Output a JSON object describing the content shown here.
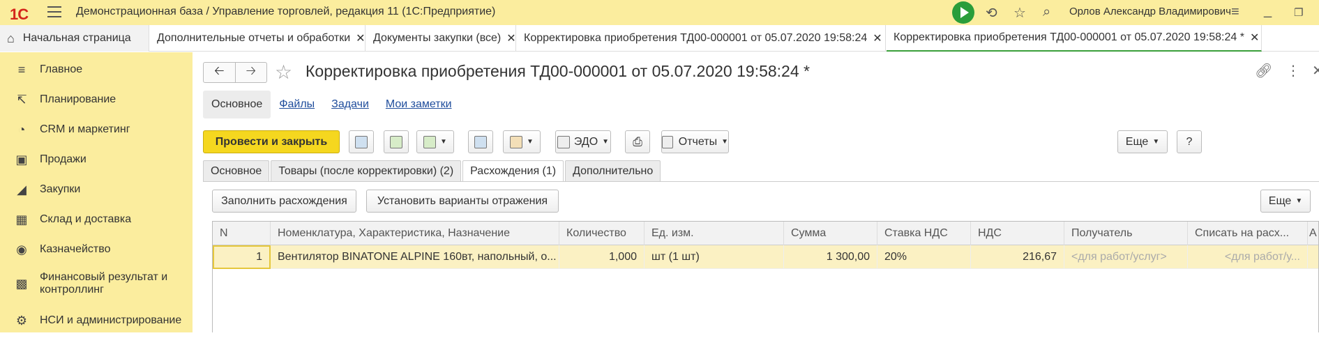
{
  "app": {
    "logo": "1С",
    "title": "Демонстрационная база / Управление торговлей, редакция 11  (1С:Предприятие)",
    "user": "Орлов Александр Владимирович"
  },
  "tabs": [
    {
      "label": "Начальная страница"
    },
    {
      "label": "Дополнительные отчеты и обработки"
    },
    {
      "label": "Документы закупки (все)"
    },
    {
      "label": "Корректировка приобретения ТД00-000001 от 05.07.2020 19:58:24"
    },
    {
      "label": "Корректировка приобретения ТД00-000001 от 05.07.2020 19:58:24 *"
    }
  ],
  "sidebar": {
    "items": [
      {
        "label": "Главное",
        "icon": "list-icon"
      },
      {
        "label": "Планирование",
        "icon": "planning-icon"
      },
      {
        "label": "CRM и маркетинг",
        "icon": "pie-icon"
      },
      {
        "label": "Продажи",
        "icon": "bag-icon"
      },
      {
        "label": "Закупки",
        "icon": "cart-icon"
      },
      {
        "label": "Склад и доставка",
        "icon": "grid-icon"
      },
      {
        "label": "Казначейство",
        "icon": "coin-icon"
      },
      {
        "label": "Финансовый результат и контроллинг",
        "icon": "bars-icon"
      },
      {
        "label": "НСИ и администрирование",
        "icon": "gear-icon"
      }
    ]
  },
  "document": {
    "title": "Корректировка приобретения ТД00-000001 от 05.07.2020 19:58:24 *",
    "sections": [
      "Основное",
      "Файлы",
      "Задачи",
      "Мои заметки"
    ]
  },
  "toolbar": {
    "post_close": "Провести и закрыть",
    "edo": "ЭДО",
    "reports": "Отчеты",
    "more": "Еще",
    "help": "?"
  },
  "page_tabs": [
    "Основное",
    "Товары (после корректировки) (2)",
    "Расхождения (1)",
    "Дополнительно"
  ],
  "table_toolbar": {
    "fill": "Заполнить расхождения",
    "set_variants": "Установить варианты отражения",
    "more": "Еще"
  },
  "table": {
    "columns": [
      "N",
      "Номенклатура, Характеристика, Назначение",
      "Количество",
      "Ед. изм.",
      "Сумма",
      "Ставка НДС",
      "НДС",
      "Получатель",
      "Списать на расх...",
      "А"
    ],
    "rows": [
      [
        "1",
        "Вентилятор BINATONE ALPINE 160вт, напольный, о...",
        "1,000",
        "шт (1 шт)",
        "1 300,00",
        "20%",
        "216,67",
        "<для работ/услуг>",
        "<для работ/у..."
      ]
    ]
  }
}
